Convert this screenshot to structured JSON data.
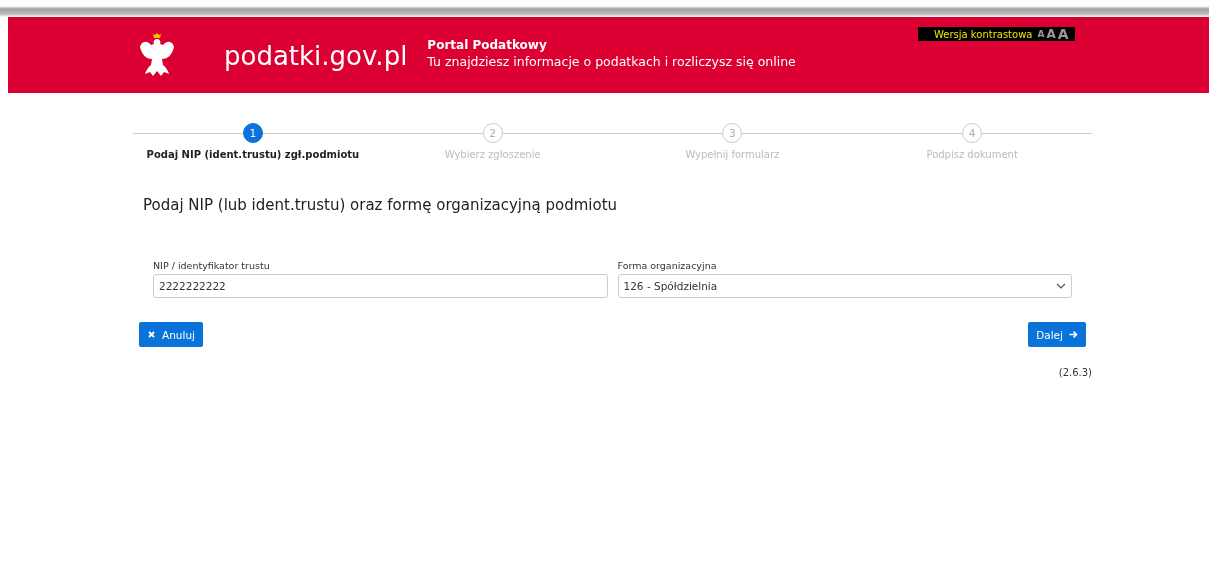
{
  "header": {
    "logo_text": "podatki.gov.pl",
    "portal_title": "Portal Podatkowy",
    "portal_subtitle": "Tu znajdziesz informacje o podatkach i rozliczysz się online",
    "contrast": {
      "label": "Wersja kontrastowa",
      "font_sizes": [
        "A",
        "A",
        "A"
      ]
    }
  },
  "steps": [
    {
      "number": "1",
      "label": "Podaj NIP (ident.trustu) zgł.podmiotu",
      "selected": true
    },
    {
      "number": "2",
      "label": "Wybierz zgłoszenie",
      "selected": false
    },
    {
      "number": "3",
      "label": "Wypełnij formularz",
      "selected": false
    },
    {
      "number": "4",
      "label": "Podpisz dokument",
      "selected": false
    }
  ],
  "heading": "Podaj NIP (lub ident.trustu) oraz formę organizacyjną podmiotu",
  "fields": [
    {
      "kind": "text",
      "label": "NIP / identyfikator trustu",
      "value": "2222222222"
    },
    {
      "kind": "select",
      "label": "Forma organizacyjna",
      "value": "126 - Spółdzielnia"
    }
  ],
  "buttons": [
    {
      "kind": "cancel",
      "label": "Anuluj"
    },
    {
      "kind": "next",
      "label": "Dalej"
    }
  ],
  "version": "(2.6.3)"
}
